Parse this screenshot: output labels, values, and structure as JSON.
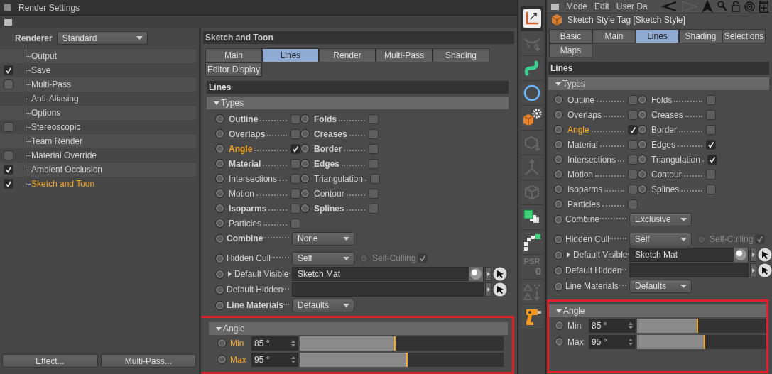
{
  "render_settings": {
    "title": "Render Settings",
    "renderer": {
      "label": "Renderer",
      "value": "Standard"
    },
    "tree": [
      {
        "label": "Output",
        "kind": "plain",
        "selected": false
      },
      {
        "label": "Save",
        "kind": "checkbox",
        "checked": true,
        "selected": false
      },
      {
        "label": "Multi-Pass",
        "kind": "checkbox",
        "checked": false,
        "selected": false
      },
      {
        "label": "Anti-Aliasing",
        "kind": "plain",
        "selected": false
      },
      {
        "label": "Options",
        "kind": "plain",
        "selected": false
      },
      {
        "label": "Stereoscopic",
        "kind": "checkbox",
        "checked": false,
        "selected": false
      },
      {
        "label": "Team Render",
        "kind": "plain",
        "selected": false
      },
      {
        "label": "Material Override",
        "kind": "checkbox",
        "checked": false,
        "selected": false
      },
      {
        "label": "Ambient Occlusion",
        "kind": "checkbox",
        "checked": true,
        "selected": false
      },
      {
        "label": "Sketch and Toon",
        "kind": "checkbox",
        "checked": true,
        "selected": true
      }
    ],
    "buttons": [
      "Effect...",
      "Multi-Pass..."
    ]
  },
  "tool_strip": {
    "psr_label": "PSR",
    "psr_value": "0"
  },
  "panels": [
    {
      "kind": "render",
      "title": "Sketch and Toon",
      "tabs": [
        {
          "label": "Main",
          "selected": false
        },
        {
          "label": "Lines",
          "selected": true
        },
        {
          "label": "Render",
          "selected": false
        },
        {
          "label": "Multi-Pass",
          "selected": false
        },
        {
          "label": "Shading",
          "selected": false
        },
        {
          "label": "Editor Display",
          "selected": false
        }
      ],
      "section": "Lines",
      "types": {
        "title": "Types",
        "expanded": true,
        "items": [
          {
            "label": "Outline",
            "bold": true,
            "checked": false,
            "accent": false
          },
          {
            "label": "Folds",
            "bold": true,
            "checked": false,
            "accent": false
          },
          {
            "label": "Overlaps",
            "bold": true,
            "checked": false,
            "accent": false
          },
          {
            "label": "Creases",
            "bold": true,
            "checked": false,
            "accent": false
          },
          {
            "label": "Angle",
            "bold": true,
            "checked": true,
            "accent": true
          },
          {
            "label": "Border",
            "bold": true,
            "checked": false,
            "accent": false
          },
          {
            "label": "Material",
            "bold": true,
            "checked": false,
            "accent": false
          },
          {
            "label": "Edges",
            "bold": true,
            "checked": false,
            "accent": false
          },
          {
            "label": "Intersections",
            "bold": false,
            "checked": false,
            "accent": false
          },
          {
            "label": "Triangulation",
            "bold": false,
            "checked": false,
            "accent": false
          },
          {
            "label": "Motion",
            "bold": false,
            "checked": false,
            "accent": false
          },
          {
            "label": "Contour",
            "bold": false,
            "checked": false,
            "accent": false
          },
          {
            "label": "Isoparms",
            "bold": true,
            "checked": false,
            "accent": false
          },
          {
            "label": "Splines",
            "bold": true,
            "checked": false,
            "accent": false
          },
          {
            "label": "Particles",
            "bold": false,
            "checked": false,
            "accent": false
          }
        ]
      },
      "params": [
        {
          "kind": "dropdown",
          "label": "Combine",
          "bold": true,
          "value": "None"
        },
        {
          "kind": "cull",
          "label": "Hidden Cull",
          "bold": false,
          "value": "Self",
          "option": {
            "label": "Self-Culling",
            "checked": true,
            "disabled": true
          }
        },
        {
          "kind": "link",
          "label": "Default Visible",
          "bold": false,
          "expander": true,
          "value": "Sketch Mat"
        },
        {
          "kind": "link",
          "label": "Default Hidden",
          "bold": false,
          "expander": false
        },
        {
          "kind": "dropdown",
          "label": "Line Materials",
          "bold": true,
          "value": "Defaults"
        }
      ],
      "angle": {
        "title": "Angle",
        "expanded": true,
        "highlighted": true,
        "rows": [
          {
            "label": "Min",
            "value": "85 °",
            "level": 0.472,
            "accent": true
          },
          {
            "label": "Max",
            "value": "95 °",
            "level": 0.528,
            "accent": true
          }
        ]
      }
    },
    {
      "kind": "attribute",
      "menu": [
        "Mode",
        "Edit",
        "User Da"
      ],
      "object_title": "Sketch Style Tag [Sketch Style]",
      "tabs": [
        {
          "label": "Basic",
          "selected": false
        },
        {
          "label": "Main",
          "selected": false
        },
        {
          "label": "Lines",
          "selected": true
        },
        {
          "label": "Shading",
          "selected": false
        },
        {
          "label": "Selections",
          "selected": false
        },
        {
          "label": "Maps",
          "selected": false
        }
      ],
      "section": "Lines",
      "types": {
        "title": "Types",
        "expanded": true,
        "items": [
          {
            "label": "Outline",
            "bold": false,
            "checked": false,
            "accent": false
          },
          {
            "label": "Folds",
            "bold": false,
            "checked": false,
            "accent": false
          },
          {
            "label": "Overlaps",
            "bold": false,
            "checked": false,
            "accent": false
          },
          {
            "label": "Creases",
            "bold": false,
            "checked": false,
            "accent": false
          },
          {
            "label": "Angle",
            "bold": false,
            "checked": true,
            "accent": true
          },
          {
            "label": "Border",
            "bold": false,
            "checked": false,
            "accent": false
          },
          {
            "label": "Material",
            "bold": false,
            "checked": false,
            "accent": false
          },
          {
            "label": "Edges",
            "bold": false,
            "checked": true,
            "accent": false
          },
          {
            "label": "Intersections",
            "bold": false,
            "checked": false,
            "accent": false
          },
          {
            "label": "Triangulation",
            "bold": false,
            "checked": true,
            "accent": false
          },
          {
            "label": "Motion",
            "bold": false,
            "checked": false,
            "accent": false
          },
          {
            "label": "Contour",
            "bold": false,
            "checked": false,
            "accent": false
          },
          {
            "label": "Isoparms",
            "bold": false,
            "checked": false,
            "accent": false
          },
          {
            "label": "Splines",
            "bold": false,
            "checked": false,
            "accent": false
          },
          {
            "label": "Particles",
            "bold": false,
            "checked": false,
            "accent": false
          }
        ]
      },
      "params": [
        {
          "kind": "dropdown",
          "label": "Combine",
          "bold": false,
          "value": "Exclusive"
        },
        {
          "kind": "cull",
          "label": "Hidden Cull",
          "bold": false,
          "value": "Self",
          "option": {
            "label": "Self-Culling",
            "checked": true,
            "disabled": true
          }
        },
        {
          "kind": "link",
          "label": "Default Visible",
          "bold": false,
          "expander": true,
          "value": "Sketch Mat"
        },
        {
          "kind": "link",
          "label": "Default Hidden",
          "bold": false,
          "expander": false
        },
        {
          "kind": "dropdown",
          "label": "Line Materials",
          "bold": false,
          "value": "Defaults"
        }
      ],
      "angle": {
        "title": "Angle",
        "expanded": true,
        "highlighted": true,
        "rows": [
          {
            "label": "Min",
            "value": "85 °",
            "level": 0.472,
            "accent": false
          },
          {
            "label": "Max",
            "value": "95 °",
            "level": 0.528,
            "accent": false
          }
        ]
      }
    }
  ]
}
